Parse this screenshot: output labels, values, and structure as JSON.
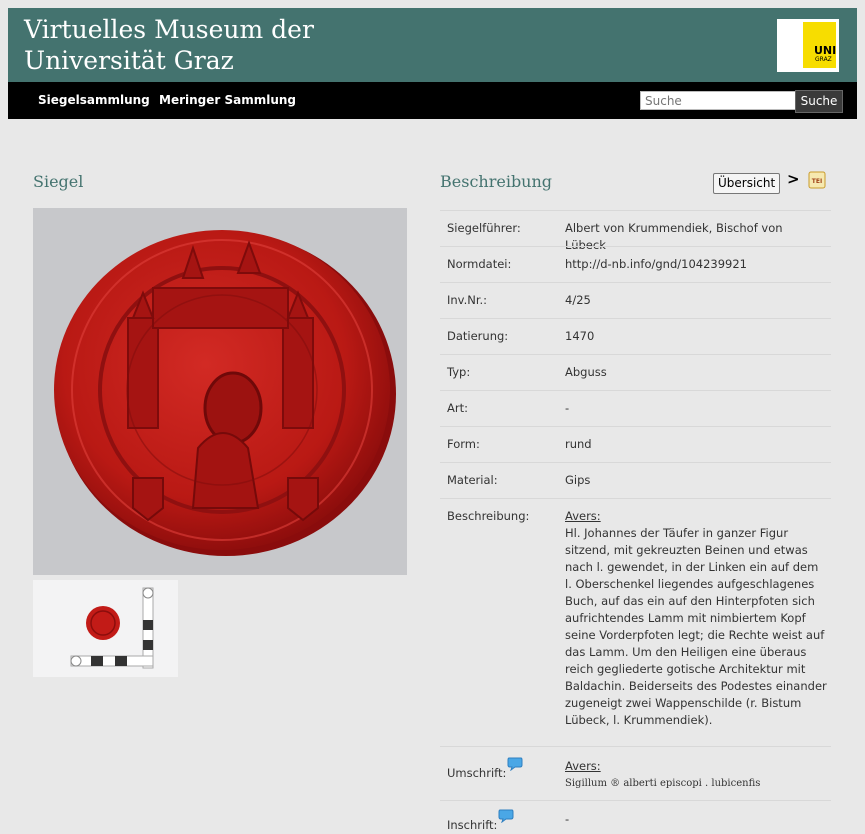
{
  "header": {
    "title_line1": "Virtuelles Museum der",
    "title_line2": "Universität Graz",
    "logo_line1": "UNI",
    "logo_line2": "GRAZ"
  },
  "nav": {
    "items": [
      "Siegelsammlung",
      "Meringer Sammlung"
    ],
    "search_placeholder": "Suche",
    "search_button": "Suche"
  },
  "left": {
    "title": "Siegel"
  },
  "right": {
    "title": "Beschreibung",
    "overview_label": "Übersicht",
    "next_label": ">",
    "tei_label": "TEI"
  },
  "details": [
    {
      "label": "Siegelführer:",
      "value": "Albert von Krummendiek, Bischof von Lübeck"
    },
    {
      "label": "Normdatei:",
      "value": "http://d-nb.info/gnd/104239921"
    },
    {
      "label": "Inv.Nr.:",
      "value": "4/25"
    },
    {
      "label": "Datierung:",
      "value": "1470"
    },
    {
      "label": "Typ:",
      "value": "Abguss"
    },
    {
      "label": "Art:",
      "value": "-"
    },
    {
      "label": "Form:",
      "value": "rund"
    },
    {
      "label": "Material:",
      "value": "Gips"
    }
  ],
  "beschreibung": {
    "label": "Beschreibung:",
    "heading": "Avers:",
    "text": "Hl. Johannes der Täufer in ganzer Figur sitzend, mit gekreuzten Beinen und etwas nach l. gewendet, in der Linken ein auf dem l. Oberschenkel liegendes aufgeschlagenes Buch, auf das ein auf den Hinterpfoten sich aufrichtendes Lamm mit nimbiertem Kopf seine Vorderpfoten legt; die Rechte weist auf das Lamm. Um den Heiligen eine überaus reich gegliederte gotische Architektur mit Baldachin. Beiderseits des Podestes einander zugeneigt zwei Wappenschilde (r. Bistum Lübeck, l. Krummendiek)."
  },
  "umschrift": {
    "label": "Umschrift:",
    "heading": "Avers:",
    "text": "Sigillum ® alberti episcopi . lubicenfis"
  },
  "inschrift": {
    "label": "Inschrift:",
    "value": "-"
  }
}
